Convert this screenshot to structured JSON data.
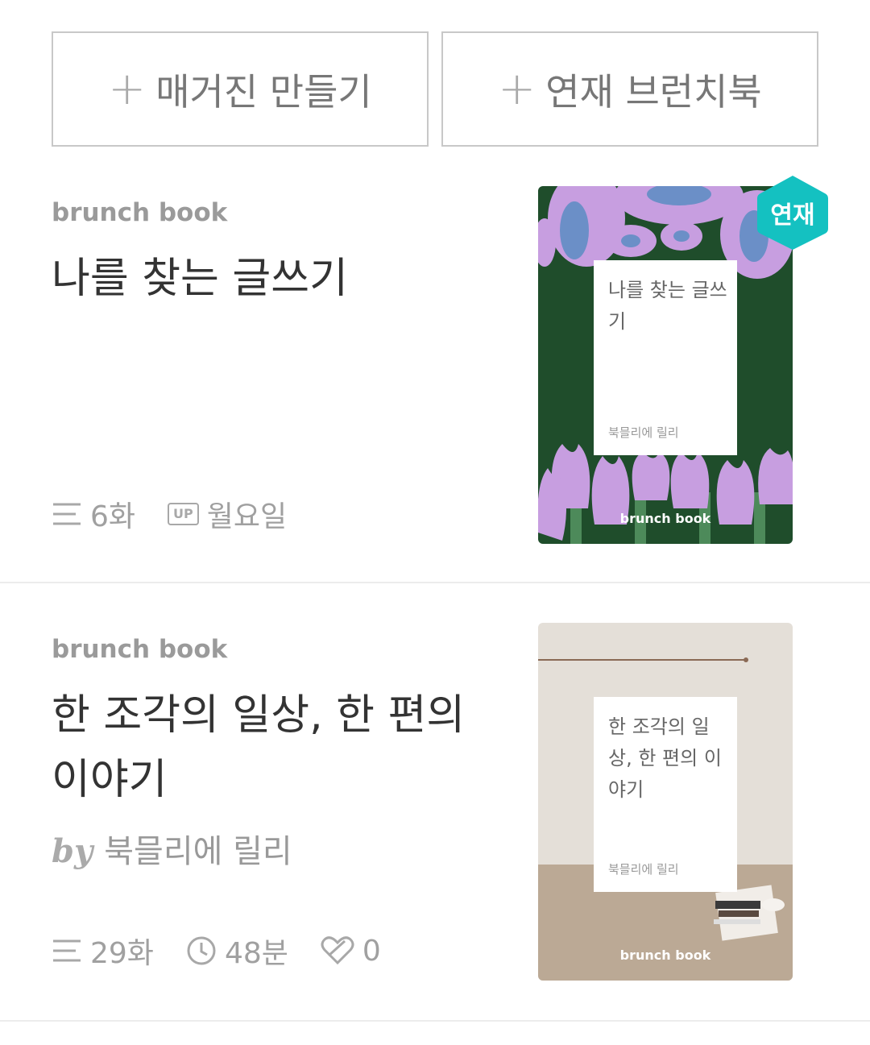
{
  "actions": {
    "create_magazine": "매거진 만들기",
    "serial_brunchbook": "연재 브런치북"
  },
  "books": [
    {
      "brand": "brunch book",
      "title": "나를 찾는 글쓰기",
      "episodes": "6화",
      "upload_tag": "UP",
      "upload_day": "월요일",
      "cover": {
        "title": "나를 찾는 글쓰기",
        "author": "북믈리에 릴리",
        "brand": "brunch book",
        "background": "#1f4d2b",
        "badge": "연재",
        "badge_color": "#14c1c1"
      }
    },
    {
      "brand": "brunch book",
      "title": "한 조각의 일상, 한 편의 이야기",
      "by": "by",
      "author": "북믈리에 릴리",
      "episodes": "29화",
      "reading_time": "48분",
      "likes": "0",
      "cover": {
        "title": "한 조각의 일상, 한 편의 이야기",
        "author": "북믈리에 릴리",
        "brand": "brunch book",
        "background": "#e4dfd8"
      }
    }
  ],
  "icons": {
    "plus": "plus-icon",
    "list": "list-icon",
    "up": "upload-day-icon",
    "clock": "clock-icon",
    "like": "heart-icon"
  }
}
